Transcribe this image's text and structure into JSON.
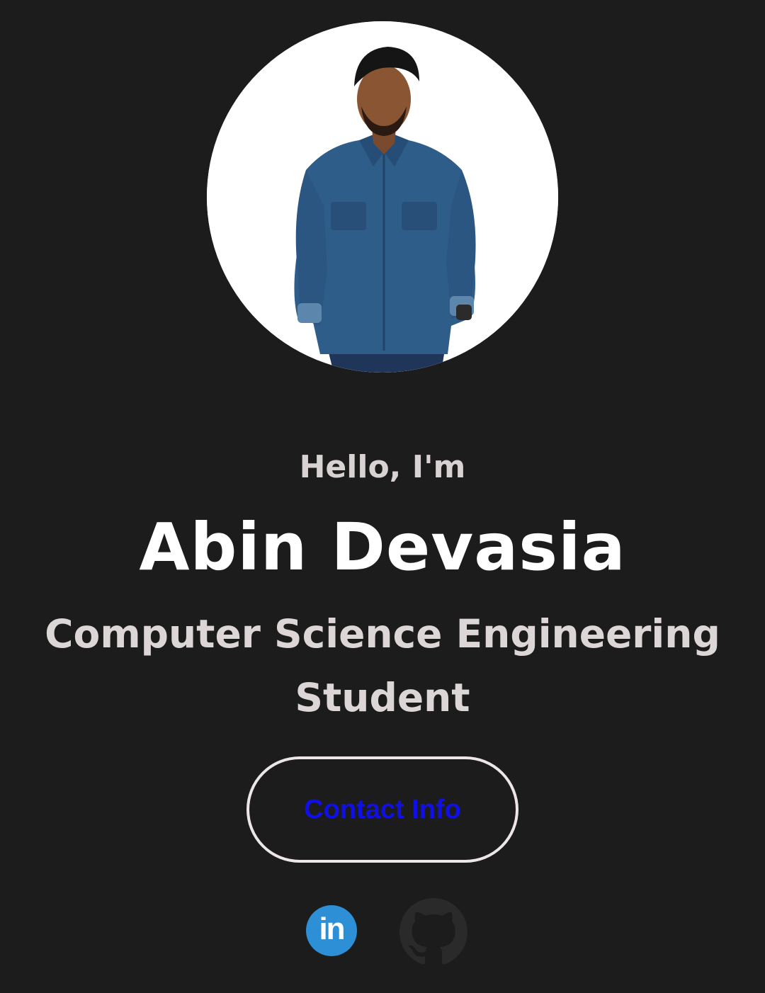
{
  "profile": {
    "greeting": "Hello, I'm",
    "name": "Abin Devasia",
    "subtitle": "Computer Science Engineering Student"
  },
  "actions": {
    "contact_label": "Contact Info"
  },
  "social": {
    "linkedin_text": "in",
    "icons": [
      "linkedin-icon",
      "github-icon"
    ]
  },
  "colors": {
    "background": "#1c1c1c",
    "name": "#ffffff",
    "greeting": "#d8d2d2",
    "contact_label": "#1010e6",
    "linkedin": "#2d8fd5",
    "github": "#2a2a2a"
  }
}
